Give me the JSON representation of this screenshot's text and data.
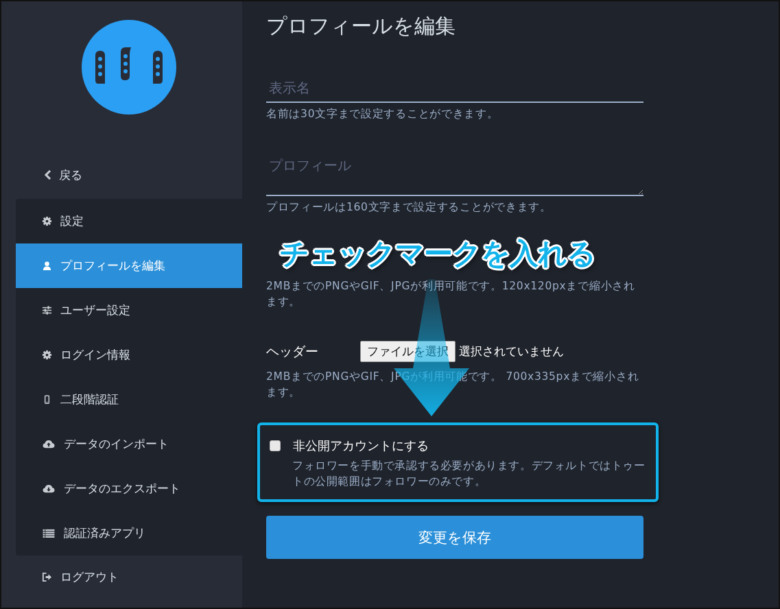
{
  "sidebar": {
    "back": {
      "label": "戻る"
    },
    "menu": [
      {
        "label": "設定",
        "kind": "settings",
        "selected": false
      },
      {
        "label": "プロフィールを編集",
        "kind": "profile",
        "selected": true
      },
      {
        "label": "ユーザー設定",
        "kind": "preferences",
        "selected": false
      },
      {
        "label": "ログイン情報",
        "kind": "login",
        "selected": false
      },
      {
        "label": "二段階認証",
        "kind": "two_factor",
        "selected": false
      },
      {
        "label": "データのインポート",
        "kind": "import",
        "selected": false
      },
      {
        "label": "データのエクスポート",
        "kind": "export",
        "selected": false
      },
      {
        "label": "認証済みアプリ",
        "kind": "apps",
        "selected": false
      }
    ],
    "logout": {
      "label": "ログアウト"
    }
  },
  "main": {
    "title": "プロフィールを編集",
    "fields": [
      {
        "kind": "input",
        "placeholder": "表示名",
        "hint": "名前は30文字まで設定することができます。"
      },
      {
        "kind": "textarea",
        "placeholder": "プロフィール",
        "hint": "プロフィールは160文字まで設定することができます。"
      }
    ],
    "uploads": [
      {
        "hint": "2MBまでのPNGやGIF、JPGが利用可能です。120x120pxまで縮小されます。"
      },
      {
        "label": "ヘッダー",
        "button": "ファイルを選択",
        "status": "選択されていません",
        "hint": "2MBまでのPNGやGIF、JPGが利用可能です。 700x335pxまで縮小されます。"
      }
    ],
    "locked": {
      "label": "非公開アカウントにする",
      "hint": "フォロワーを手動で承認する必要があります。デフォルトではトゥートの公開範囲はフォロワーのみです。",
      "checked": false
    },
    "save_button": "変更を保存"
  },
  "annotation": {
    "text": "チェックマークを入れる"
  }
}
